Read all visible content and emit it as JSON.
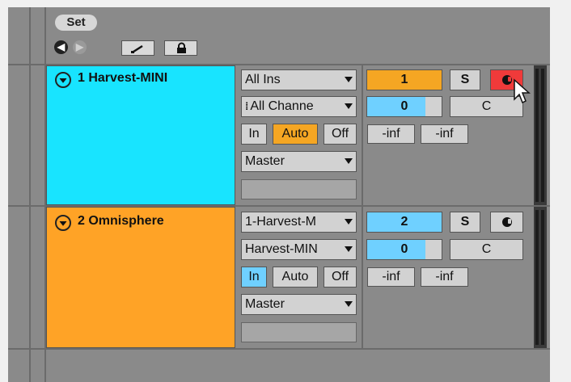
{
  "header": {
    "set_label": "Set",
    "back_icon": "arrow-left-icon",
    "forward_icon": "arrow-right-icon",
    "draw_mode_icon": "pencil-icon",
    "lock_icon": "lock-icon"
  },
  "tracks": [
    {
      "name": "1 Harvest-MINI",
      "color": "#18e4ff",
      "input_type": "All Ins",
      "input_channel": "All Channe",
      "monitor": [
        "In",
        "Auto",
        "Off"
      ],
      "monitor_active": "Auto",
      "output": "Master",
      "number": "1",
      "volume": "0",
      "pan": "C",
      "solo": "S",
      "meter_left": "-inf",
      "meter_right": "-inf",
      "armed": true
    },
    {
      "name": "2 Omnisphere",
      "color": "#ffa326",
      "input_type": "1-Harvest-M",
      "input_channel": "Harvest-MIN",
      "monitor": [
        "In",
        "Auto",
        "Off"
      ],
      "monitor_active": "In",
      "output": "Master",
      "number": "2",
      "volume": "0",
      "pan": "C",
      "solo": "S",
      "meter_left": "-inf",
      "meter_right": "-inf",
      "armed": false
    }
  ],
  "colors": {
    "accent_orange": "#f5a623",
    "accent_blue": "#6fd0ff",
    "arm_red": "#f03a3a"
  }
}
